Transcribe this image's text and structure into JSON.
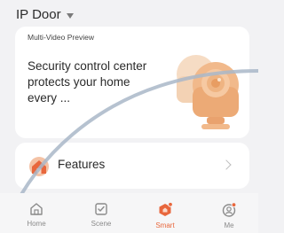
{
  "header": {
    "title": "IP Door"
  },
  "preview": {
    "label": "Multi-Video Preview",
    "description": "Security control center protects your home every ..."
  },
  "features": {
    "label": "Features"
  },
  "tabs": [
    {
      "label": "Home",
      "icon": "home-icon",
      "active": false
    },
    {
      "label": "Scene",
      "icon": "scene-icon",
      "active": false
    },
    {
      "label": "Smart",
      "icon": "smart-icon",
      "active": true
    },
    {
      "label": "Me",
      "icon": "me-icon",
      "active": false
    }
  ],
  "colors": {
    "accent": "#e8673d",
    "background": "#f2f2f4",
    "card": "#ffffff",
    "tab_inactive": "#8a8a8a",
    "camera_illustration": "#f0b98a"
  }
}
